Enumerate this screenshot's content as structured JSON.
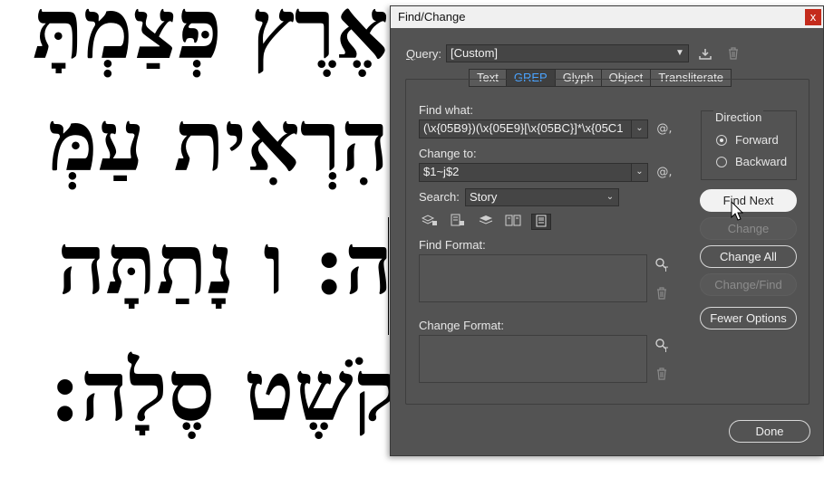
{
  "document": {
    "lines": [
      "אֶרֶץ פְּצַמְתָּ",
      "הִרְאִית עַמְּ",
      "ה: ו נָתַתָּה",
      "קֹשֶׁט סֶלָה:"
    ]
  },
  "dialog": {
    "title": "Find/Change",
    "close_glyph": "x",
    "query": {
      "label": "Query:",
      "value": "[Custom]"
    },
    "tabs": [
      {
        "label": "Text",
        "active": false
      },
      {
        "label": "GREP",
        "active": true
      },
      {
        "label": "Glyph",
        "active": false
      },
      {
        "label": "Object",
        "active": false
      },
      {
        "label": "Transliterate",
        "active": false
      }
    ],
    "find_what": {
      "label": "Find what:",
      "value": "(\\x{05B9})(\\x{05E9}[\\x{05BC}]*\\x{05C1"
    },
    "change_to": {
      "label": "Change to:",
      "value": "$1~j$2"
    },
    "search": {
      "label": "Search:",
      "value": "Story"
    },
    "find_format": {
      "label": "Find Format:"
    },
    "change_format": {
      "label": "Change Format:"
    },
    "direction": {
      "label": "Direction",
      "forward": "Forward",
      "backward": "Backward",
      "selected": "Forward"
    },
    "buttons": {
      "find_next": "Find Next",
      "change": "Change",
      "change_all": "Change All",
      "change_find": "Change/Find",
      "fewer_options": "Fewer Options",
      "done": "Done"
    },
    "special_char_glyph": "@,",
    "colors": {
      "active_tab_text": "#4aa3ff",
      "dialog_bg": "#535353",
      "close_bg": "#c42b1c"
    }
  }
}
